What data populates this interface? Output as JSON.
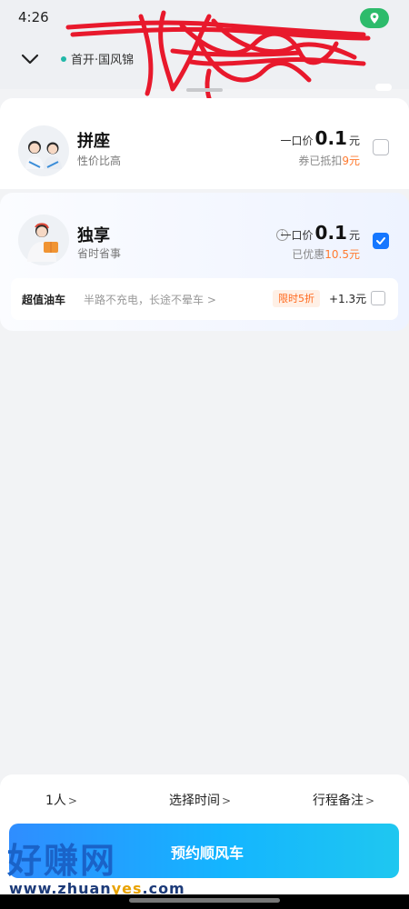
{
  "status_bar": {
    "time": "4:26"
  },
  "header": {
    "route_text": "首开·国风锦"
  },
  "options": {
    "carpool": {
      "title": "拼座",
      "subtitle": "性价比高",
      "price_prefix": "一口价",
      "price": "0.1",
      "price_unit": "元",
      "discount_prefix": "券已抵扣",
      "discount_amount": "9元",
      "checked": false
    },
    "exclusive": {
      "title": "独享",
      "subtitle": "省时省事",
      "price_prefix": "一口价",
      "price": "0.1",
      "price_unit": "元",
      "discount_prefix": "已优惠",
      "discount_amount": "10.5元",
      "checked": true
    }
  },
  "addon": {
    "title": "超值油车",
    "description": "半路不充电，长途不晕车 >",
    "tag": "限时5折",
    "price": "+1.3元",
    "checked": false
  },
  "bottom_bar": {
    "passengers": "1人",
    "time_select": "选择时间",
    "trip_note": "行程备注",
    "book_button": "预约顺风车"
  },
  "watermark": {
    "text": "好赚网",
    "url_prefix": "www.zhuan",
    "url_highlight": "yes",
    "url_suffix": ".com"
  },
  "colors": {
    "accent_blue": "#1677ff",
    "discount_orange": "#ff7a2f",
    "location_green": "#2dbb6b"
  }
}
